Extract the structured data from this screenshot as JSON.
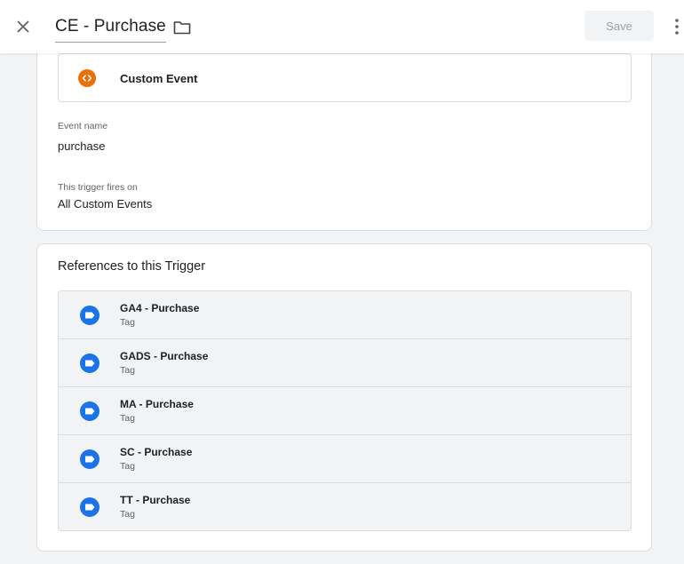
{
  "header": {
    "title": "CE - Purchase",
    "save_label": "Save",
    "icons": [
      "close-icon",
      "folder-icon",
      "more-vert-icon"
    ]
  },
  "trigger": {
    "type_label": "Custom Event",
    "type_icon": "custom-event-icon",
    "type_icon_color": "#e8710a",
    "event_name_label": "Event name",
    "event_name_value": "purchase",
    "fires_on_label": "This trigger fires on",
    "fires_on_value": "All Custom Events"
  },
  "references": {
    "title": "References to this Trigger",
    "tag_icon_color": "#1a73e8",
    "items": [
      {
        "name": "GA4 - Purchase",
        "type": "Tag"
      },
      {
        "name": "GADS - Purchase",
        "type": "Tag"
      },
      {
        "name": "MA - Purchase",
        "type": "Tag"
      },
      {
        "name": "SC - Purchase",
        "type": "Tag"
      },
      {
        "name": "TT - Purchase",
        "type": "Tag"
      }
    ]
  }
}
